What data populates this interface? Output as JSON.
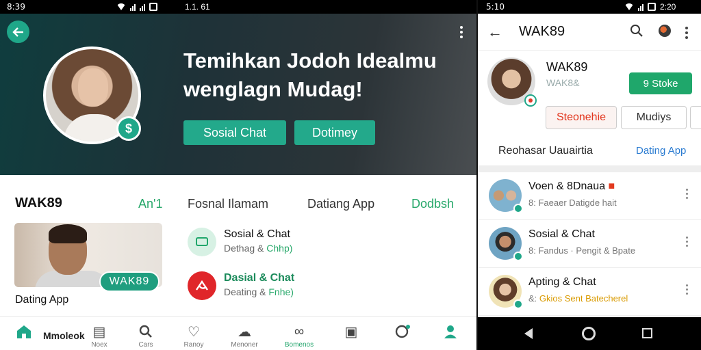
{
  "left_status": {
    "time": "8:39",
    "mid": "1.1. 61"
  },
  "right_status": {
    "time": "5:10",
    "clock": "2:20"
  },
  "hero": {
    "title_line1": "Temihkan Jodoh Idealmu",
    "title_line2": "wenglagn Mudag!",
    "badge": "$",
    "btn_social": "Sosial Chat",
    "btn_dating": "Dotimey"
  },
  "profile_row": {
    "name": "WAK89",
    "an": "An'1",
    "fosnal": "Fosnal Ilamam",
    "dating": "Datiang App",
    "dodi": "Dodbsh"
  },
  "photo_card": {
    "tag": "WAK89",
    "caption": "Dating App"
  },
  "left_chats": [
    {
      "title": "Sosial & Chat",
      "sub_a": "Dethag & ",
      "sub_b": "Chhp)"
    },
    {
      "title": "Dasial & Chat",
      "sub_a": "Deating & ",
      "sub_b": "Fnhe)"
    }
  ],
  "bottom_nav": {
    "home_label": "Mmoleok",
    "items": [
      "Noex",
      "Cars",
      "Ranoy",
      "Menoner",
      "Bomenos",
      "",
      "",
      ""
    ]
  },
  "right_top": {
    "title": "WAK89"
  },
  "right_profile": {
    "name": "WAK89",
    "sub": "WAK8&",
    "btn": "9 Stoke",
    "chip1": "Steonehie",
    "chip2": "Mudiys",
    "row_left": "Reohasar Uauairtia",
    "row_right": "Dating App"
  },
  "right_list": [
    {
      "title": "Voen & 8Dnaua",
      "sub": "8: Faeaer Datigde hait"
    },
    {
      "title": "Sosial & Chat",
      "sub": "8: Fandus · Pengit & Bpate"
    },
    {
      "title": "Apting & Chat",
      "sub_a": "&: ",
      "sub_b": "Gkios Sent Batecherel"
    }
  ]
}
